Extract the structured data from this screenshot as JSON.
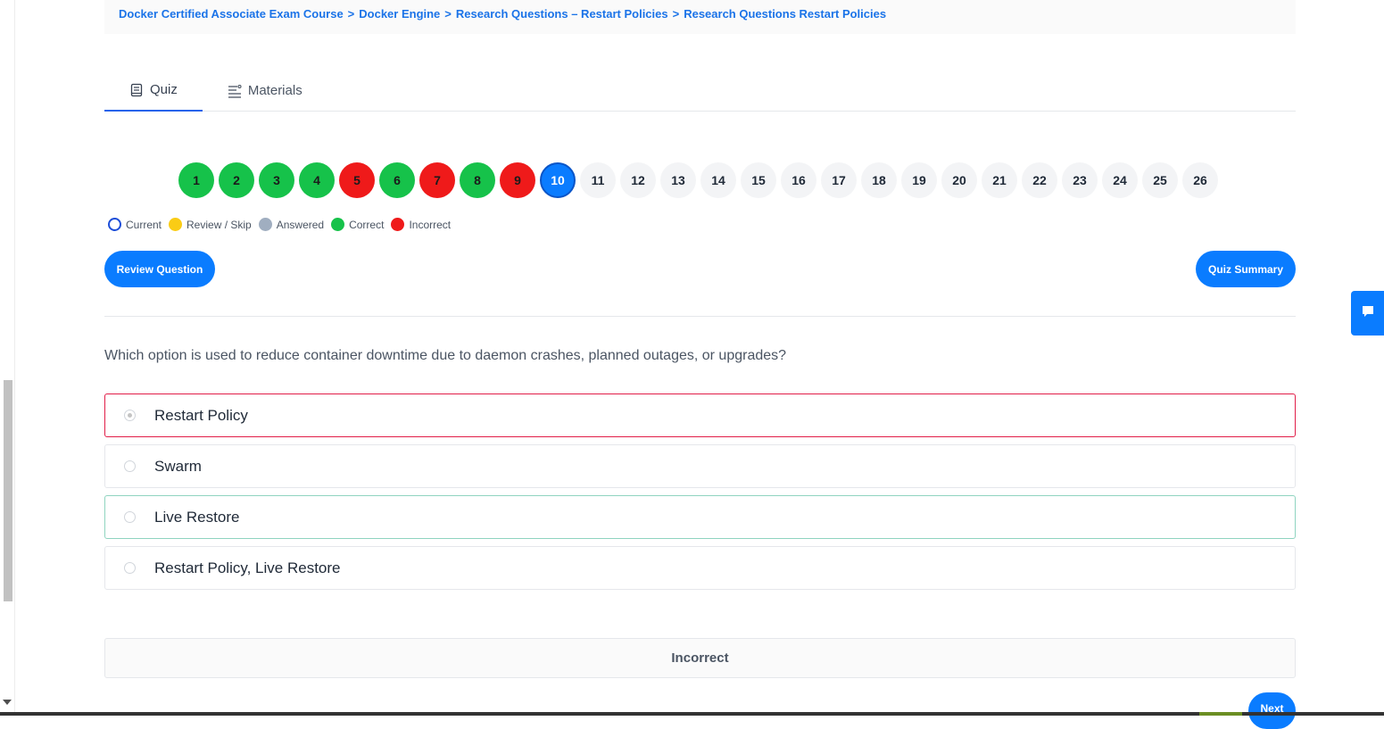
{
  "breadcrumb": {
    "items": [
      "Docker Certified Associate Exam Course",
      "Docker Engine",
      "Research Questions – Restart Policies",
      "Research Questions Restart Policies"
    ],
    "separator": ">"
  },
  "tabs": [
    {
      "label": "Quiz",
      "icon": "book-icon",
      "active": true
    },
    {
      "label": "Materials",
      "icon": "list-icon",
      "active": false
    }
  ],
  "question_nav": [
    {
      "num": "1",
      "status": "correct"
    },
    {
      "num": "2",
      "status": "correct"
    },
    {
      "num": "3",
      "status": "correct"
    },
    {
      "num": "4",
      "status": "correct"
    },
    {
      "num": "5",
      "status": "incorrect"
    },
    {
      "num": "6",
      "status": "correct"
    },
    {
      "num": "7",
      "status": "incorrect"
    },
    {
      "num": "8",
      "status": "correct"
    },
    {
      "num": "9",
      "status": "incorrect"
    },
    {
      "num": "10",
      "status": "current"
    },
    {
      "num": "11",
      "status": "none"
    },
    {
      "num": "12",
      "status": "none"
    },
    {
      "num": "13",
      "status": "none"
    },
    {
      "num": "14",
      "status": "none"
    },
    {
      "num": "15",
      "status": "none"
    },
    {
      "num": "16",
      "status": "none"
    },
    {
      "num": "17",
      "status": "none"
    },
    {
      "num": "18",
      "status": "none"
    },
    {
      "num": "19",
      "status": "none"
    },
    {
      "num": "20",
      "status": "none"
    },
    {
      "num": "21",
      "status": "none"
    },
    {
      "num": "22",
      "status": "none"
    },
    {
      "num": "23",
      "status": "none"
    },
    {
      "num": "24",
      "status": "none"
    },
    {
      "num": "25",
      "status": "none"
    },
    {
      "num": "26",
      "status": "none"
    }
  ],
  "legend": {
    "current": "Current",
    "review": "Review / Skip",
    "answered": "Answered",
    "correct": "Correct",
    "incorrect": "Incorrect"
  },
  "colors": {
    "accent": "#0a7cff",
    "correct": "#16c24a",
    "incorrect": "#ef1a1a",
    "review": "#facc15",
    "answered": "#a0aec0"
  },
  "buttons": {
    "review_question": "Review Question",
    "quiz_summary": "Quiz Summary",
    "next": "Next"
  },
  "question": {
    "text": "Which option is used to reduce container downtime due to daemon crashes, planned outages, or upgrades?",
    "options": [
      {
        "label": "Restart Policy",
        "selected": true,
        "state": "wrong"
      },
      {
        "label": "Swarm",
        "selected": false,
        "state": "neutral"
      },
      {
        "label": "Live Restore",
        "selected": false,
        "state": "right"
      },
      {
        "label": "Restart Policy, Live Restore",
        "selected": false,
        "state": "neutral"
      }
    ]
  },
  "result": "Incorrect"
}
